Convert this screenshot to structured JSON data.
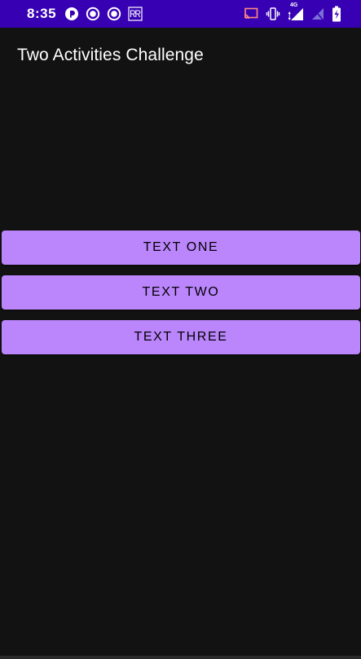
{
  "status_bar": {
    "time": "8:35",
    "left_icons": [
      "pocket-casts-icon",
      "record-icon",
      "record-icon",
      "rr-icon"
    ],
    "right_icons": [
      "cast-icon",
      "vibrate-icon",
      "signal-4g-icon",
      "no-signal-icon",
      "battery-icon"
    ],
    "network_label": "4G",
    "background_color": "#3700B3"
  },
  "app_bar": {
    "title": "Two Activities Challenge"
  },
  "buttons": [
    {
      "label": "TEXT ONE"
    },
    {
      "label": "TEXT TWO"
    },
    {
      "label": "TEXT THREE"
    }
  ],
  "colors": {
    "accent": "#BB86FC",
    "background": "#121212"
  }
}
